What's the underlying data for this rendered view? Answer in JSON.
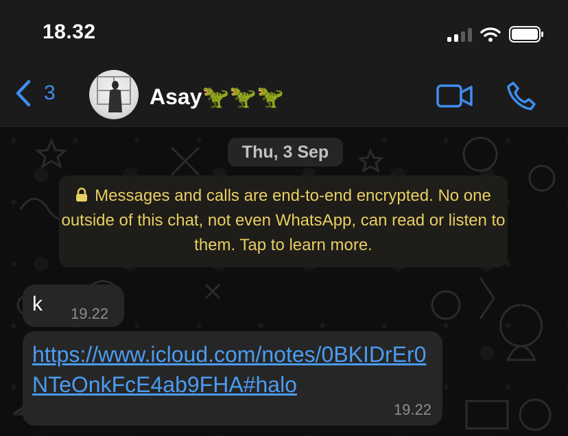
{
  "status_bar": {
    "time": "18.32"
  },
  "header": {
    "back_count": "3",
    "contact_name": "Asay🦖🦖🦖"
  },
  "chat": {
    "date_label": "Thu, 3 Sep",
    "encryption_notice": "Messages and calls are end-to-end encrypted. No one outside of this chat, not even WhatsApp, can read or listen to them. Tap to learn more.",
    "messages": [
      {
        "text": "k",
        "time": "19.22"
      },
      {
        "link": "https://www.icloud.com/notes/0BKIDrEr0NTeOnkFcE4ab9FHA#halo",
        "time": "19.22"
      }
    ]
  },
  "colors": {
    "accent": "#3e8eef",
    "link": "#4b9cf2",
    "notice_text": "#e8cf62",
    "bubble": "#262626",
    "header_bg": "#1b1b1b"
  },
  "icons": [
    "signal-icon",
    "wifi-icon",
    "battery-icon",
    "chevron-left-icon",
    "video-call-icon",
    "phone-icon",
    "lock-icon"
  ]
}
